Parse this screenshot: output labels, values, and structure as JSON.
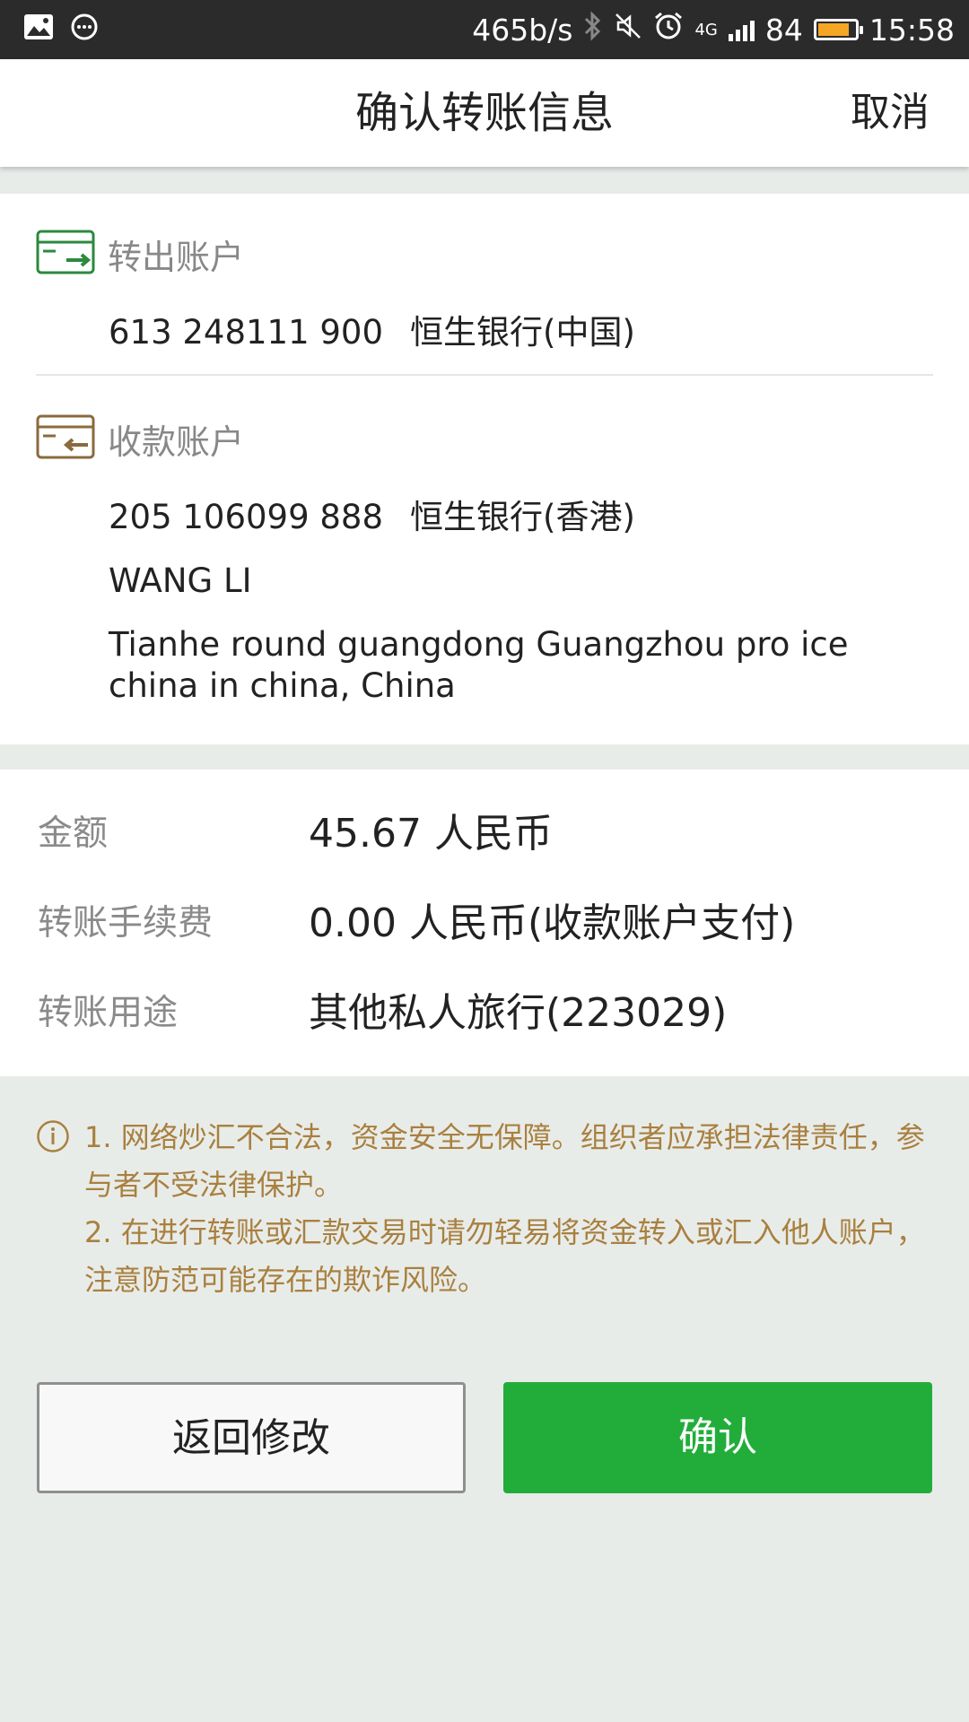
{
  "status_bar": {
    "speed": "465b/s",
    "network": "4G",
    "battery_percent": "84",
    "time": "15:58"
  },
  "header": {
    "title": "确认转账信息",
    "cancel_label": "取消"
  },
  "from_account": {
    "label": "转出账户",
    "number": "613 248111 900",
    "bank": "恒生银行(中国)"
  },
  "to_account": {
    "label": "收款账户",
    "number": "205 106099 888",
    "bank": "恒生银行(香港)",
    "name": "WANG LI",
    "address": "Tianhe round guangdong Guangzhou pro ice china in china, China"
  },
  "details": [
    {
      "label": "金额",
      "value": "45.67 人民币"
    },
    {
      "label": "转账手续费",
      "value": "0.00 人民币(收款账户支付)"
    },
    {
      "label": "转账用途",
      "value": "其他私人旅行(223029)"
    }
  ],
  "warning": {
    "line1": "1. 网络炒汇不合法，资金安全无保障。组织者应承担法律责任，参与者不受法律保护。",
    "line2": "2. 在进行转账或汇款交易时请勿轻易将资金转入或汇入他人账户，注意防范可能存在的欺诈风险。"
  },
  "buttons": {
    "back_label": "返回修改",
    "confirm_label": "确认"
  },
  "colors": {
    "primary": "#22ad3b",
    "warning_text": "#a9803f",
    "from_icon": "#2b8a3e",
    "to_icon": "#8b6a3e"
  }
}
